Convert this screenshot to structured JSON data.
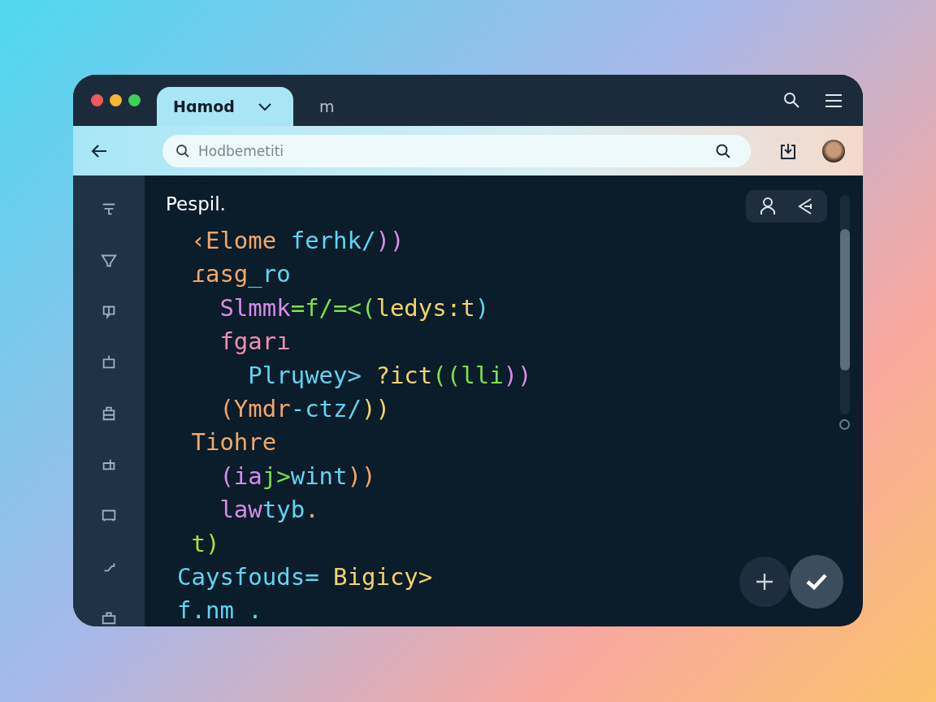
{
  "tabs": [
    {
      "label": "Hɑmod",
      "selected": true
    },
    {
      "label": "m",
      "selected": false
    }
  ],
  "address_bar": {
    "placeholder": "Hodbemetiti"
  },
  "editor": {
    "title": "Pespil.",
    "lines": [
      {
        "tokens": [
          {
            "text": " ‹Elome",
            "color": "#f0a868"
          },
          {
            "text": " ferhk/",
            "color": "#5fd6ee"
          },
          {
            "text": "))",
            "color": "#d98be8"
          }
        ]
      },
      {
        "tokens": [
          {
            "text": " ɾasg",
            "color": "#f0a868"
          },
          {
            "text": "_ro",
            "color": "#5fd6ee"
          }
        ]
      },
      {
        "tokens": [
          {
            "text": "   Slmmk",
            "color": "#d98be8"
          },
          {
            "text": "=f/=<(",
            "color": "#7fe04a"
          },
          {
            "text": "ledys:t",
            "color": "#f2d36a"
          },
          {
            "text": ")",
            "color": "#5fd6ee"
          }
        ]
      },
      {
        "tokens": [
          {
            "text": "   fgarı",
            "color": "#f08fb0"
          }
        ]
      },
      {
        "tokens": [
          {
            "text": "     Plrɥwey>",
            "color": "#5fd6ee"
          },
          {
            "text": " ?ict",
            "color": "#f2d36a"
          },
          {
            "text": "((lli",
            "color": "#7fe04a"
          },
          {
            "text": "))",
            "color": "#d98be8"
          }
        ]
      },
      {
        "tokens": [
          {
            "text": "   (Ymdr",
            "color": "#f0a868"
          },
          {
            "text": "-ctz/",
            "color": "#5fd6ee"
          },
          {
            "text": "))",
            "color": "#f2d36a"
          }
        ]
      },
      {
        "tokens": [
          {
            "text": " Tiohre",
            "color": "#f0a868"
          }
        ]
      },
      {
        "tokens": [
          {
            "text": "   (ia",
            "color": "#d98be8"
          },
          {
            "text": "j>",
            "color": "#7fe04a"
          },
          {
            "text": "wint",
            "color": "#5fd6ee"
          },
          {
            "text": "))",
            "color": "#f0a868"
          }
        ]
      },
      {
        "tokens": [
          {
            "text": "   law",
            "color": "#d98be8"
          },
          {
            "text": "tyb",
            "color": "#5fd6ee"
          },
          {
            "text": ".",
            "color": "#f0a868"
          }
        ]
      },
      {
        "tokens": [
          {
            "text": " t)",
            "color": "#a8e040"
          }
        ]
      },
      {
        "tokens": [
          {
            "text": "Caysfouds=",
            "color": "#5fd6ee"
          },
          {
            "text": " Bigicy>",
            "color": "#f2d36a"
          }
        ]
      },
      {
        "tokens": [
          {
            "text": "f.nm .",
            "color": "#5fd6ee"
          }
        ]
      }
    ]
  }
}
